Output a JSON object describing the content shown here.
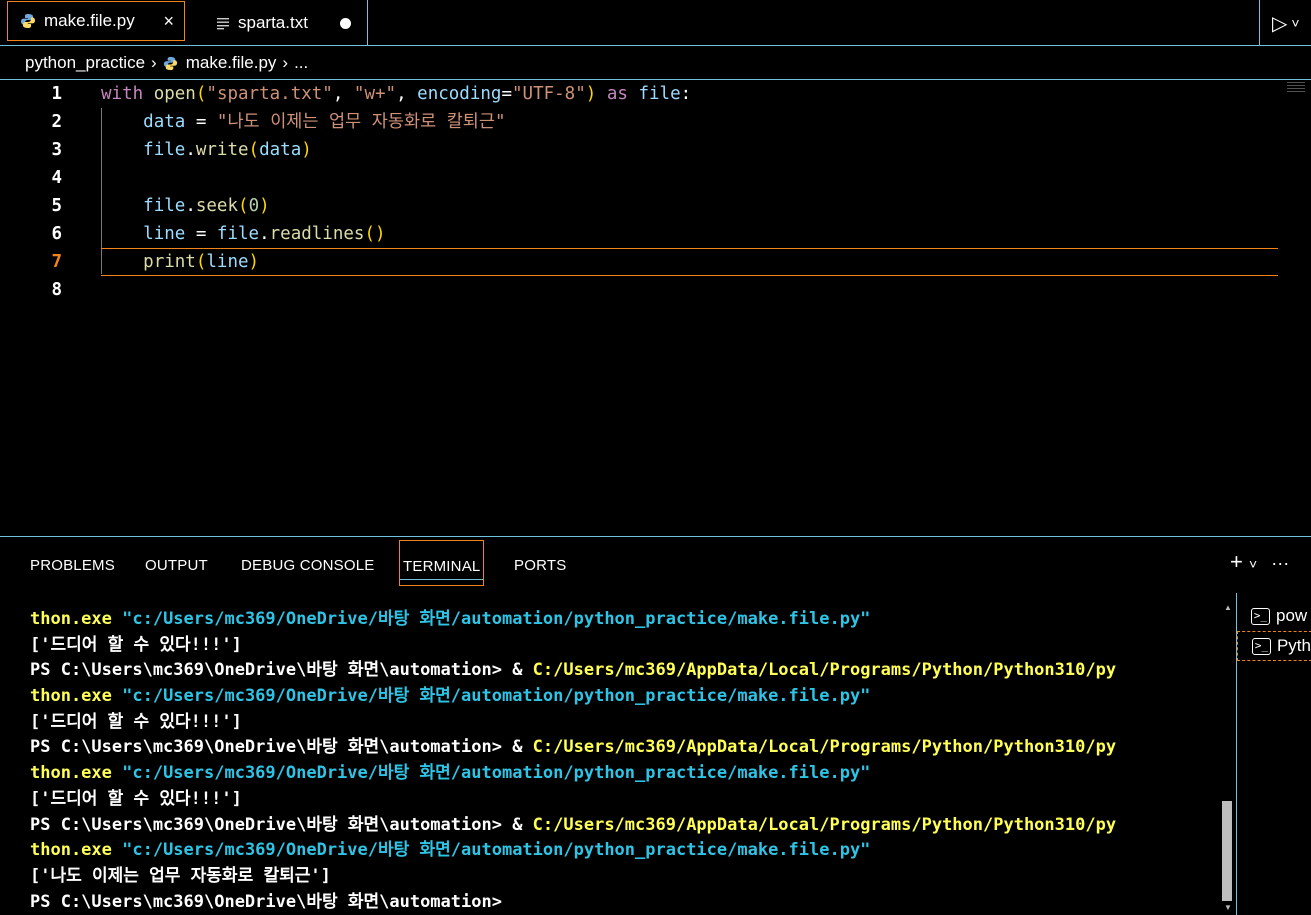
{
  "tabs": [
    {
      "label": "make.file.py",
      "icon": "python-icon",
      "active": true,
      "close": "×"
    },
    {
      "label": "sparta.txt",
      "icon": "text-file-icon",
      "active": false,
      "unsaved": true
    }
  ],
  "run_button": {
    "play": "▷",
    "chevron": "˅"
  },
  "breadcrumb": {
    "folder": "python_practice",
    "sep1": "›",
    "file": "make.file.py",
    "sep2": "›",
    "more": "..."
  },
  "editor": {
    "line_numbers": [
      "1",
      "2",
      "3",
      "4",
      "5",
      "6",
      "7",
      "8"
    ],
    "current_line": 7,
    "lines": [
      [
        {
          "t": "with",
          "c": "kw"
        },
        {
          "t": " ",
          "c": "op"
        },
        {
          "t": "open",
          "c": "fn"
        },
        {
          "t": "(",
          "c": "br"
        },
        {
          "t": "\"sparta.txt\"",
          "c": "str"
        },
        {
          "t": ", ",
          "c": "op"
        },
        {
          "t": "\"w+\"",
          "c": "str"
        },
        {
          "t": ", ",
          "c": "op"
        },
        {
          "t": "encoding",
          "c": "var"
        },
        {
          "t": "=",
          "c": "op"
        },
        {
          "t": "\"UTF-8\"",
          "c": "str"
        },
        {
          "t": ")",
          "c": "br"
        },
        {
          "t": " ",
          "c": "op"
        },
        {
          "t": "as",
          "c": "kw"
        },
        {
          "t": " ",
          "c": "op"
        },
        {
          "t": "file",
          "c": "var"
        },
        {
          "t": ":",
          "c": "op"
        }
      ],
      [
        {
          "t": "    ",
          "c": "op"
        },
        {
          "t": "data",
          "c": "var"
        },
        {
          "t": " = ",
          "c": "op"
        },
        {
          "t": "\"나도 이제는 업무 자동화로 칼퇴근\"",
          "c": "str"
        }
      ],
      [
        {
          "t": "    ",
          "c": "op"
        },
        {
          "t": "file",
          "c": "var"
        },
        {
          "t": ".",
          "c": "op"
        },
        {
          "t": "write",
          "c": "fn"
        },
        {
          "t": "(",
          "c": "br"
        },
        {
          "t": "data",
          "c": "var"
        },
        {
          "t": ")",
          "c": "br"
        }
      ],
      [],
      [
        {
          "t": "    ",
          "c": "op"
        },
        {
          "t": "file",
          "c": "var"
        },
        {
          "t": ".",
          "c": "op"
        },
        {
          "t": "seek",
          "c": "fn"
        },
        {
          "t": "(",
          "c": "br"
        },
        {
          "t": "0",
          "c": "num"
        },
        {
          "t": ")",
          "c": "br"
        }
      ],
      [
        {
          "t": "    ",
          "c": "op"
        },
        {
          "t": "line",
          "c": "var"
        },
        {
          "t": " = ",
          "c": "op"
        },
        {
          "t": "file",
          "c": "var"
        },
        {
          "t": ".",
          "c": "op"
        },
        {
          "t": "readlines",
          "c": "fn"
        },
        {
          "t": "()",
          "c": "br"
        }
      ],
      [
        {
          "t": "    ",
          "c": "op"
        },
        {
          "t": "print",
          "c": "fn"
        },
        {
          "t": "(",
          "c": "br"
        },
        {
          "t": "line",
          "c": "var"
        },
        {
          "t": ")",
          "c": "br"
        }
      ],
      []
    ]
  },
  "panel": {
    "tabs": [
      "PROBLEMS",
      "OUTPUT",
      "DEBUG CONSOLE",
      "TERMINAL",
      "PORTS"
    ],
    "active_tab": "TERMINAL",
    "actions": {
      "add": "+",
      "chevron": "˅",
      "more": "···"
    },
    "terminal_list": [
      "pow",
      "Pyth"
    ]
  },
  "terminal": {
    "lines": [
      [
        {
          "t": "thon.exe ",
          "c": "t-ylw"
        },
        {
          "t": "\"c:/Users/mc369/OneDrive/바탕 화면/automation/python_practice/make.file.py\"",
          "c": "t-cyan"
        }
      ],
      [
        {
          "t": "['드디어 할 수 있다!!!']",
          "c": "t-wht"
        }
      ],
      [
        {
          "t": "PS C:\\Users\\mc369\\OneDrive\\바탕 화면\\automation> & ",
          "c": "t-wht"
        },
        {
          "t": "C:/Users/mc369/AppData/Local/Programs/Python/Python310/py",
          "c": "t-ylw"
        }
      ],
      [
        {
          "t": "thon.exe ",
          "c": "t-ylw"
        },
        {
          "t": "\"c:/Users/mc369/OneDrive/바탕 화면/automation/python_practice/make.file.py\"",
          "c": "t-cyan"
        }
      ],
      [
        {
          "t": "['드디어 할 수 있다!!!']",
          "c": "t-wht"
        }
      ],
      [
        {
          "t": "PS C:\\Users\\mc369\\OneDrive\\바탕 화면\\automation> & ",
          "c": "t-wht"
        },
        {
          "t": "C:/Users/mc369/AppData/Local/Programs/Python/Python310/py",
          "c": "t-ylw"
        }
      ],
      [
        {
          "t": "thon.exe ",
          "c": "t-ylw"
        },
        {
          "t": "\"c:/Users/mc369/OneDrive/바탕 화면/automation/python_practice/make.file.py\"",
          "c": "t-cyan"
        }
      ],
      [
        {
          "t": "['드디어 할 수 있다!!!']",
          "c": "t-wht"
        }
      ],
      [
        {
          "t": "PS C:\\Users\\mc369\\OneDrive\\바탕 화면\\automation> & ",
          "c": "t-wht"
        },
        {
          "t": "C:/Users/mc369/AppData/Local/Programs/Python/Python310/py",
          "c": "t-ylw"
        }
      ],
      [
        {
          "t": "thon.exe ",
          "c": "t-ylw"
        },
        {
          "t": "\"c:/Users/mc369/OneDrive/바탕 화면/automation/python_practice/make.file.py\"",
          "c": "t-cyan"
        }
      ],
      [
        {
          "t": "['나도 이제는 업무 자동화로 칼퇴근']",
          "c": "t-wht"
        }
      ],
      [
        {
          "t": "PS C:\\Users\\mc369\\OneDrive\\바탕 화면\\automation>",
          "c": "t-wht"
        }
      ]
    ]
  },
  "colors": {
    "accent_border": "#f38518",
    "contrast_border": "#6fc3df",
    "background": "#000000"
  }
}
